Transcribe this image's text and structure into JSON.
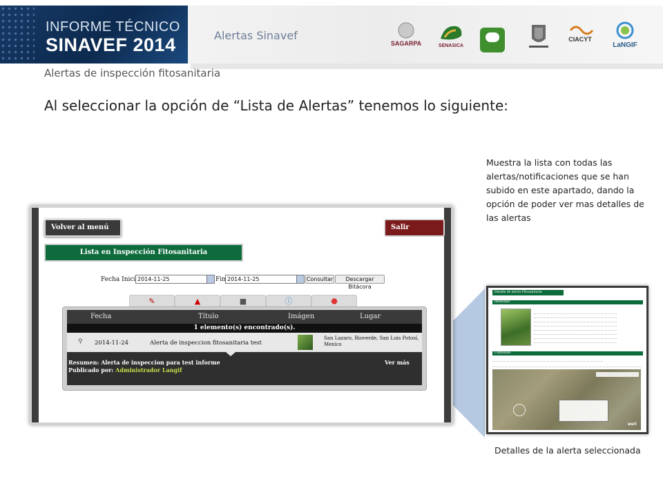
{
  "header": {
    "banner_line1": "INFORME TÉCNICO",
    "banner_line2": "SINAVEF 2014",
    "title": "Alertas Sinavef",
    "logos": [
      "SAGARPA",
      "SENASICA",
      "",
      "",
      "CIACYT",
      "LaNGIF"
    ]
  },
  "subtitle": "Alertas de inspección fitosanitaria",
  "heading": "Al seleccionar la opción de “Lista de Alertas” tenemos lo siguiente:",
  "description": "Muestra la lista con todas las alertas/notificaciones que se han subido en este apartado, dando la opción de poder ver mas detalles de las alertas",
  "caption": "Detalles de la alerta seleccionada",
  "screenshot": {
    "back_button": "Volver al menú",
    "exit_button": "Salir",
    "list_title": "Lista en Inspección Fitosanitaria",
    "fecha_inicio_label": "Fecha Inicio:",
    "fecha_inicio_value": "2014-11-25",
    "fin_label": "Fin:",
    "fin_value": "2014-11-25",
    "consultar_button": "Consultar",
    "descargar_button": "Descargar Bitácora",
    "columns": [
      "Fecha",
      "Título",
      "Imágen",
      "Lugar"
    ],
    "found_text": "1 elemento(s) encontrado(s).",
    "row": {
      "fecha": "2014-11-24",
      "titulo": "Alerta de inspeccion fitosanitaria test",
      "lugar": "San Lazaro, Rioverde, San Luis Potosí, Mexico"
    },
    "resumen_label": "Resumen:",
    "resumen_value": "Alerta de inspeccion para test informe",
    "publicado_label": "Publicado por:",
    "publicado_value": "Administrador Langif",
    "ver_mas": "Ver más"
  },
  "details": {
    "title": "Detalle de alerta Fitosanitaria",
    "identidad": "Identidad",
    "contenido": "Contenido",
    "map_logo": "esri"
  },
  "colors": {
    "green": "#0d6b3c",
    "dark_red": "#7a1a1a",
    "banner_blue": "#163a66",
    "callout_blue": "#b6c9e2"
  }
}
